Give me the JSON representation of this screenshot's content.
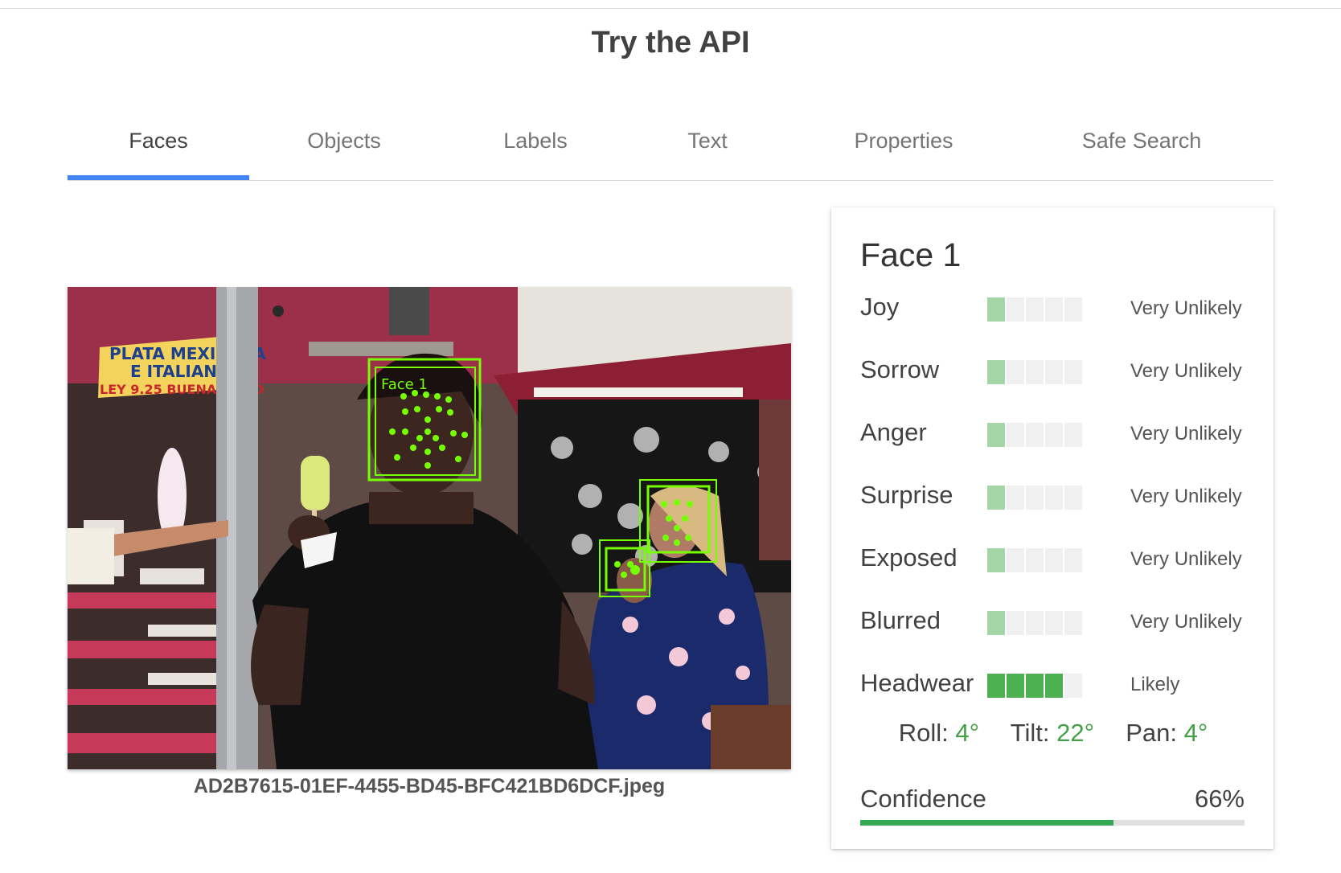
{
  "page": {
    "title": "Try the API"
  },
  "tabs": [
    {
      "label": "Faces",
      "active": true
    },
    {
      "label": "Objects",
      "active": false
    },
    {
      "label": "Labels",
      "active": false
    },
    {
      "label": "Text",
      "active": false
    },
    {
      "label": "Properties",
      "active": false
    },
    {
      "label": "Safe Search",
      "active": false
    }
  ],
  "image": {
    "filename": "AD2B7615-01EF-4455-BD45-BFC421BD6DCF.jpeg",
    "sign_text": [
      "PLATA MEXICANA",
      "E ITALIANA",
      "LEY 9.25 BUENA CALID"
    ],
    "face_box_label": "Face 1"
  },
  "face_card": {
    "title": "Face 1",
    "attributes": [
      {
        "name": "Joy",
        "value": "Very Unlikely",
        "level": 1
      },
      {
        "name": "Sorrow",
        "value": "Very Unlikely",
        "level": 1
      },
      {
        "name": "Anger",
        "value": "Very Unlikely",
        "level": 1
      },
      {
        "name": "Surprise",
        "value": "Very Unlikely",
        "level": 1
      },
      {
        "name": "Exposed",
        "value": "Very Unlikely",
        "level": 1
      },
      {
        "name": "Blurred",
        "value": "Very Unlikely",
        "level": 1
      },
      {
        "name": "Headwear",
        "value": "Likely",
        "level": 4
      }
    ],
    "angles": {
      "roll_label": "Roll:",
      "roll": "4°",
      "tilt_label": "Tilt:",
      "tilt": "22°",
      "pan_label": "Pan:",
      "pan": "4°"
    },
    "confidence": {
      "label": "Confidence",
      "value": "66%",
      "fraction": 0.66
    }
  },
  "colors": {
    "tab_indicator": "#4285f4",
    "likelihood_low": "#a5d6a7",
    "likelihood_high": "#4caf50",
    "angle_value": "#43a047",
    "confidence_bar": "#34a853",
    "face_box": "#76ff03"
  }
}
